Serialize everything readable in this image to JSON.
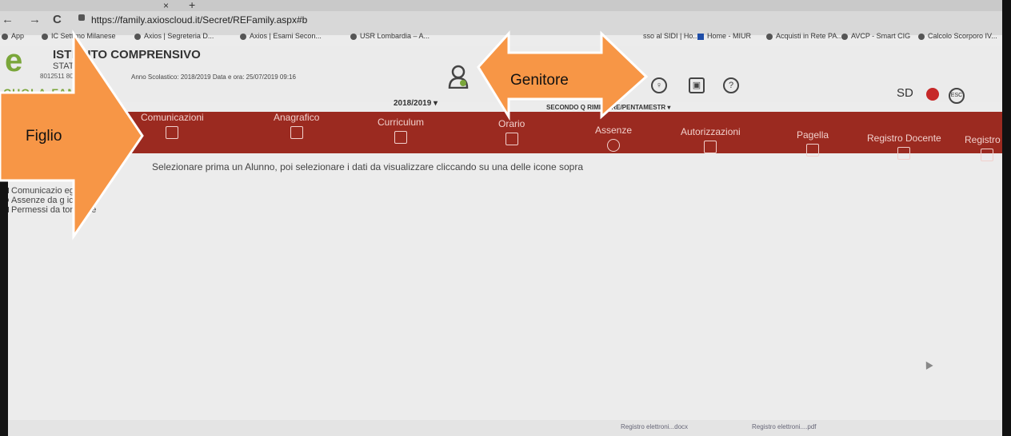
{
  "browser": {
    "tab_close": "×",
    "tab_new": "+",
    "back": "←",
    "forward": "→",
    "reload": "C",
    "url": "https://family.axioscloud.it/Secret/REFamily.aspx#b",
    "bookmarks": [
      "App",
      "IC Settimo Milanese",
      "Axios | Segreteria D...",
      "Axios | Esami Secon...",
      "USR Lombardia – A...",
      "sso al SIDI | Ho...",
      "Home - MIUR",
      "Acquisti in Rete PA...",
      "AVCP - Smart CIG",
      "Calcolo Scorporo IV..."
    ]
  },
  "header": {
    "logo_letter": "e",
    "school_name": "ISTITUTO COMPRENSIVO",
    "school_sub": "STATALE",
    "school_code": "8012511 80151",
    "year_info": "Anno Scolastico: 2018/2019   Data e ora: 25/07/2019 09:16",
    "brand": "CUOLA-FAM   LIA",
    "year_selector": "2018/2019  ▾",
    "period_selector": "SECONDO Q       RIMESTRE/PENTAMESTR ▾",
    "icon_b": "♀",
    "icon_c": "▣",
    "icon_d": "?",
    "sd_logo": "SD",
    "esc_badge": "ESC"
  },
  "menu": [
    {
      "label": "Comunicazioni"
    },
    {
      "label": "Anagrafico"
    },
    {
      "label": "Curriculum"
    },
    {
      "label": "Orario"
    },
    {
      "label": "Assenze"
    },
    {
      "label": "Autorizzazioni"
    },
    {
      "label": "Pagella"
    },
    {
      "label": "Registro Docente"
    },
    {
      "label": "Registro C"
    }
  ],
  "main": {
    "instruction": "Selezionare prima un Alunno, poi selezionare i dati da visualizzare cliccando su una delle icone sopra",
    "side_items": [
      "Comunicazio       eggere",
      "Assenze da g       icare",
      "Permessi da      torizzare"
    ]
  },
  "downloads": [
    "Registro elettroni...docx",
    "Registro elettroni....pdf"
  ],
  "annotations": {
    "figlio_label": "Figlio",
    "genitore_label": "Genitore",
    "arrow_color": "#f79646",
    "arrow_stroke": "#ffffff"
  }
}
